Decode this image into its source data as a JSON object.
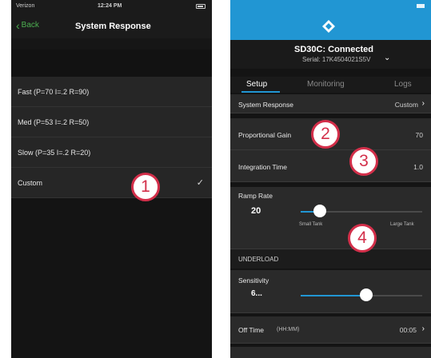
{
  "left_phone": {
    "status": {
      "carrier": "Verizon",
      "time": "12:24 PM"
    },
    "nav": {
      "back_label": "Back",
      "title": "System Response"
    },
    "options": [
      {
        "label": "Fast (P=70 I=.2 R=90)"
      },
      {
        "label": "Med (P=53 I=.2 R=50)"
      },
      {
        "label": "Slow (P=35 I=.2 R=20)"
      },
      {
        "label": "Custom"
      }
    ],
    "selected": "Custom",
    "check_glyph": "✓"
  },
  "right_phone": {
    "device": {
      "title": "SD30C: Connected",
      "serial": "Serial: 17K4504021S5V"
    },
    "tabs": [
      {
        "label": "Setup",
        "active": true
      },
      {
        "label": "Monitoring",
        "active": false
      },
      {
        "label": "Logs",
        "active": false
      }
    ],
    "system_response": {
      "label": "System Response",
      "value": "Custom"
    },
    "proportional_gain": {
      "label": "Proportional Gain",
      "value": "70"
    },
    "integration_time": {
      "label": "Integration Time",
      "value": "1.0"
    },
    "ramp_rate": {
      "label": "Ramp Rate",
      "value": "20",
      "min_label": "Small Tank",
      "max_label": "Large Tank",
      "level": 0.15
    },
    "underload": {
      "section": "UNDERLOAD"
    },
    "sensitivity": {
      "label": "Sensitivity",
      "value": "6...",
      "level": 0.55
    },
    "off_time": {
      "label": "Off Time",
      "unit": "(HH:MM)",
      "value": "00:05"
    }
  },
  "badges": [
    "1",
    "2",
    "3",
    "4"
  ],
  "colors": {
    "accent_blue": "#2196d3",
    "back_green": "#4caf50",
    "badge_red": "#d32f4a"
  }
}
